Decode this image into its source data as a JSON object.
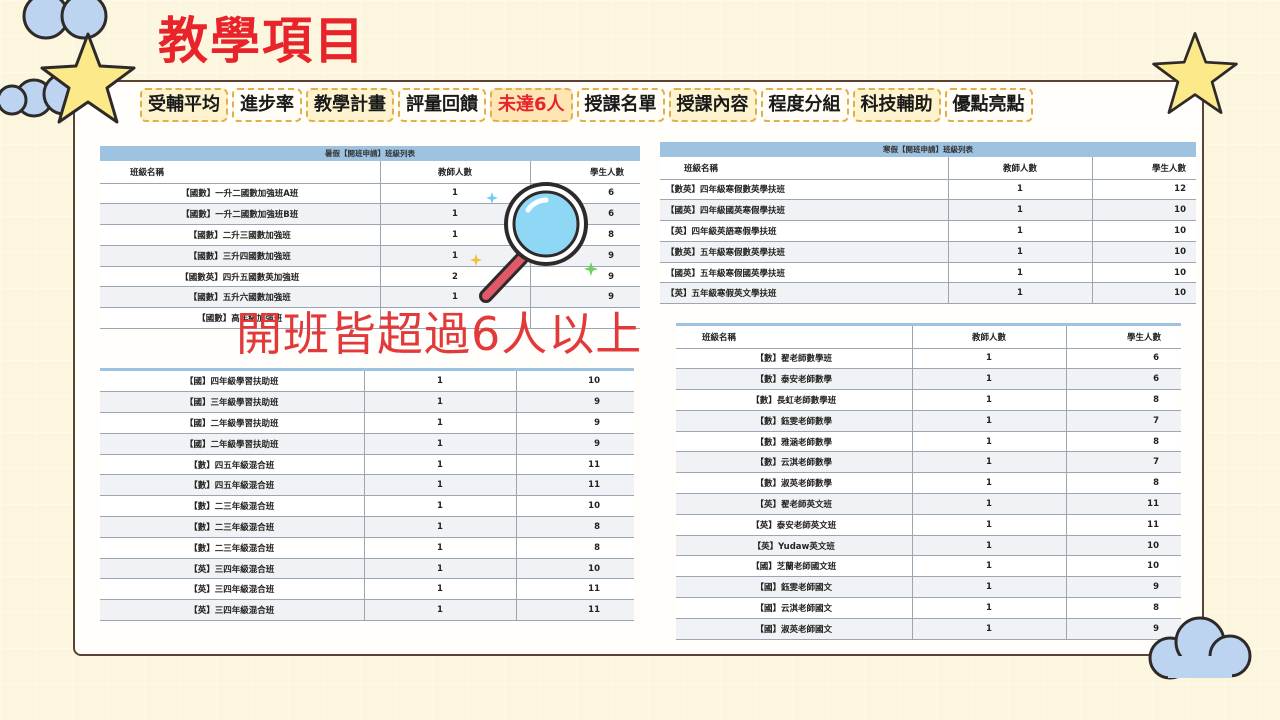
{
  "title": "教學項目",
  "tabs": [
    {
      "label": "受輔平均",
      "active": false
    },
    {
      "label": "進步率",
      "active": false
    },
    {
      "label": "教學計畫",
      "active": false
    },
    {
      "label": "評量回饋",
      "active": false
    },
    {
      "label": "未達6人",
      "active": true
    },
    {
      "label": "授課名單",
      "active": false
    },
    {
      "label": "授課內容",
      "active": false
    },
    {
      "label": "程度分組",
      "active": false
    },
    {
      "label": "科技輔助",
      "active": false
    },
    {
      "label": "優點亮點",
      "active": false
    }
  ],
  "headers": {
    "name": "班級名稱",
    "teachers": "教師人數",
    "students": "學生人數"
  },
  "summer": {
    "caption": "暑假【開班申請】班級列表",
    "rows": [
      [
        "【國數】一升二國數加強班A班",
        "1",
        "6"
      ],
      [
        "【國數】一升二國數加強班B班",
        "1",
        "6"
      ],
      [
        "【國數】二升三國數加強班",
        "1",
        "8"
      ],
      [
        "【國數】三升四國數加強班",
        "1",
        "9"
      ],
      [
        "【國數英】四升五國數英加強班",
        "2",
        "9"
      ],
      [
        "【國數】五升六國數加強班",
        "1",
        "9"
      ],
      [
        "【國數】高年級加強班",
        "",
        ""
      ]
    ]
  },
  "lower_left": {
    "rows": [
      [
        "【國】四年級學習扶助班",
        "1",
        "10"
      ],
      [
        "【國】三年級學習扶助班",
        "1",
        "9"
      ],
      [
        "【國】二年級學習扶助班",
        "1",
        "9"
      ],
      [
        "【國】二年級學習扶助班",
        "1",
        "9"
      ],
      [
        "【數】四五年級混合班",
        "1",
        "11"
      ],
      [
        "【數】四五年級混合班",
        "1",
        "11"
      ],
      [
        "【數】二三年級混合班",
        "1",
        "10"
      ],
      [
        "【數】二三年級混合班",
        "1",
        "8"
      ],
      [
        "【數】二三年級混合班",
        "1",
        "8"
      ],
      [
        "【英】三四年級混合班",
        "1",
        "10"
      ],
      [
        "【英】三四年級混合班",
        "1",
        "11"
      ],
      [
        "【英】三四年級混合班",
        "1",
        "11"
      ]
    ]
  },
  "winter": {
    "caption": "寒假【開班申請】班級列表",
    "rows": [
      [
        "【數英】四年級寒假數英學扶班",
        "1",
        "12"
      ],
      [
        "【國英】四年級國英寒假學扶班",
        "1",
        "10"
      ],
      [
        "【英】四年級英語寒假學扶班",
        "1",
        "10"
      ],
      [
        "【數英】五年級寒假數英學扶班",
        "1",
        "10"
      ],
      [
        "【國英】五年級寒假國英學扶班",
        "1",
        "10"
      ],
      [
        "【英】五年級寒假英文學扶班",
        "1",
        "10"
      ]
    ]
  },
  "lower_right": {
    "rows": [
      [
        "【數】翟老師數學班",
        "1",
        "6"
      ],
      [
        "【數】泰安老師數學",
        "1",
        "6"
      ],
      [
        "【數】長虹老師數學班",
        "1",
        "8"
      ],
      [
        "【數】鈺雯老師數學",
        "1",
        "7"
      ],
      [
        "【數】雅涵老師數學",
        "1",
        "8"
      ],
      [
        "【數】云淇老師數學",
        "1",
        "7"
      ],
      [
        "【數】淑英老師數學",
        "1",
        "8"
      ],
      [
        "【英】翟老師英文班",
        "1",
        "11"
      ],
      [
        "【英】泰安老師英文班",
        "1",
        "11"
      ],
      [
        "【英】Yudaw英文班",
        "1",
        "10"
      ],
      [
        "【國】芝蘭老師國文班",
        "1",
        "10"
      ],
      [
        "【國】鈺雯老師國文",
        "1",
        "9"
      ],
      [
        "【國】云淇老師國文",
        "1",
        "8"
      ],
      [
        "【國】淑英老師國文",
        "1",
        "9"
      ]
    ]
  },
  "overlay_text": "開班皆超過6人以上",
  "colors": {
    "accent": "#e8232a",
    "caption_bg": "#9ec3e0",
    "tab_border": "#e2b04a"
  },
  "icons": [
    "magnifier-icon",
    "star-icon",
    "cloud-icon",
    "sparkle-icon"
  ]
}
